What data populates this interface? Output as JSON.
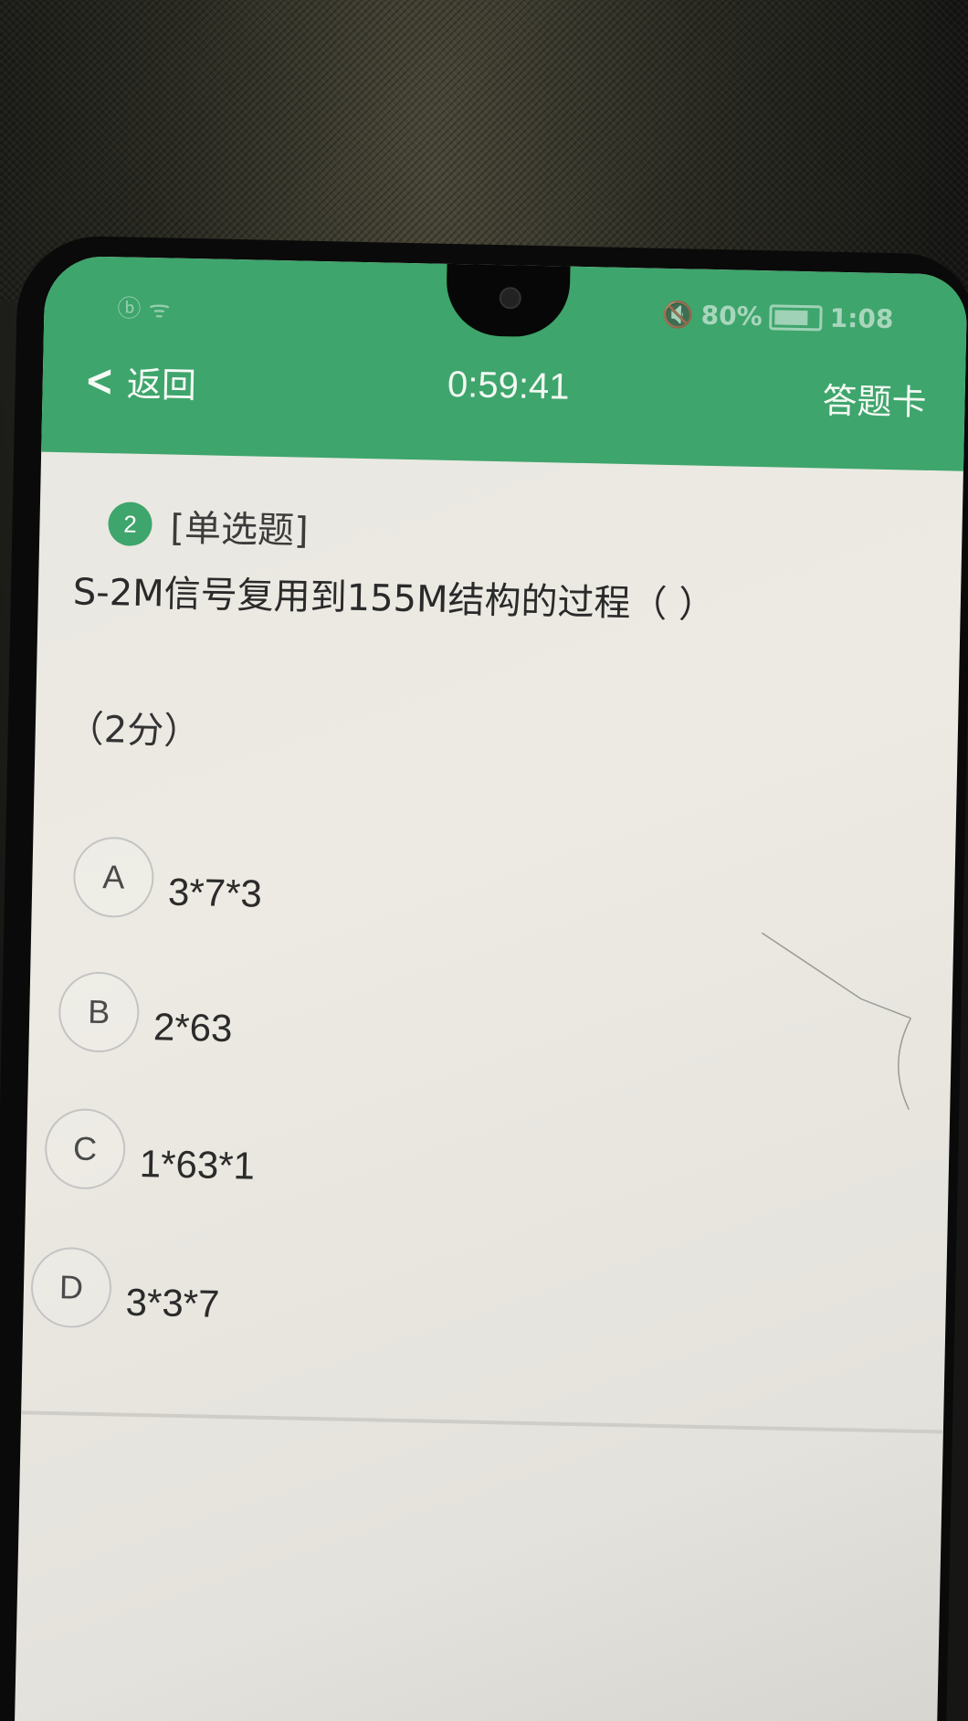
{
  "status_bar": {
    "left": "ⓑ ᯤ",
    "battery": "80%",
    "time": "1:08"
  },
  "header": {
    "back_label": "返回",
    "timer": "0:59:41",
    "answer_card": "答题卡"
  },
  "question": {
    "number": "2",
    "type": "[单选题]",
    "text": "S-2M信号复用到155M结构的过程（ ）",
    "score": "（2分）"
  },
  "options": [
    {
      "letter": "A",
      "text": "3*7*3"
    },
    {
      "letter": "B",
      "text": "2*63"
    },
    {
      "letter": "C",
      "text": "1*63*1"
    },
    {
      "letter": "D",
      "text": "3*3*7"
    }
  ],
  "colors": {
    "header_bg": "#3ea56c",
    "badge_bg": "#3ea56c"
  }
}
